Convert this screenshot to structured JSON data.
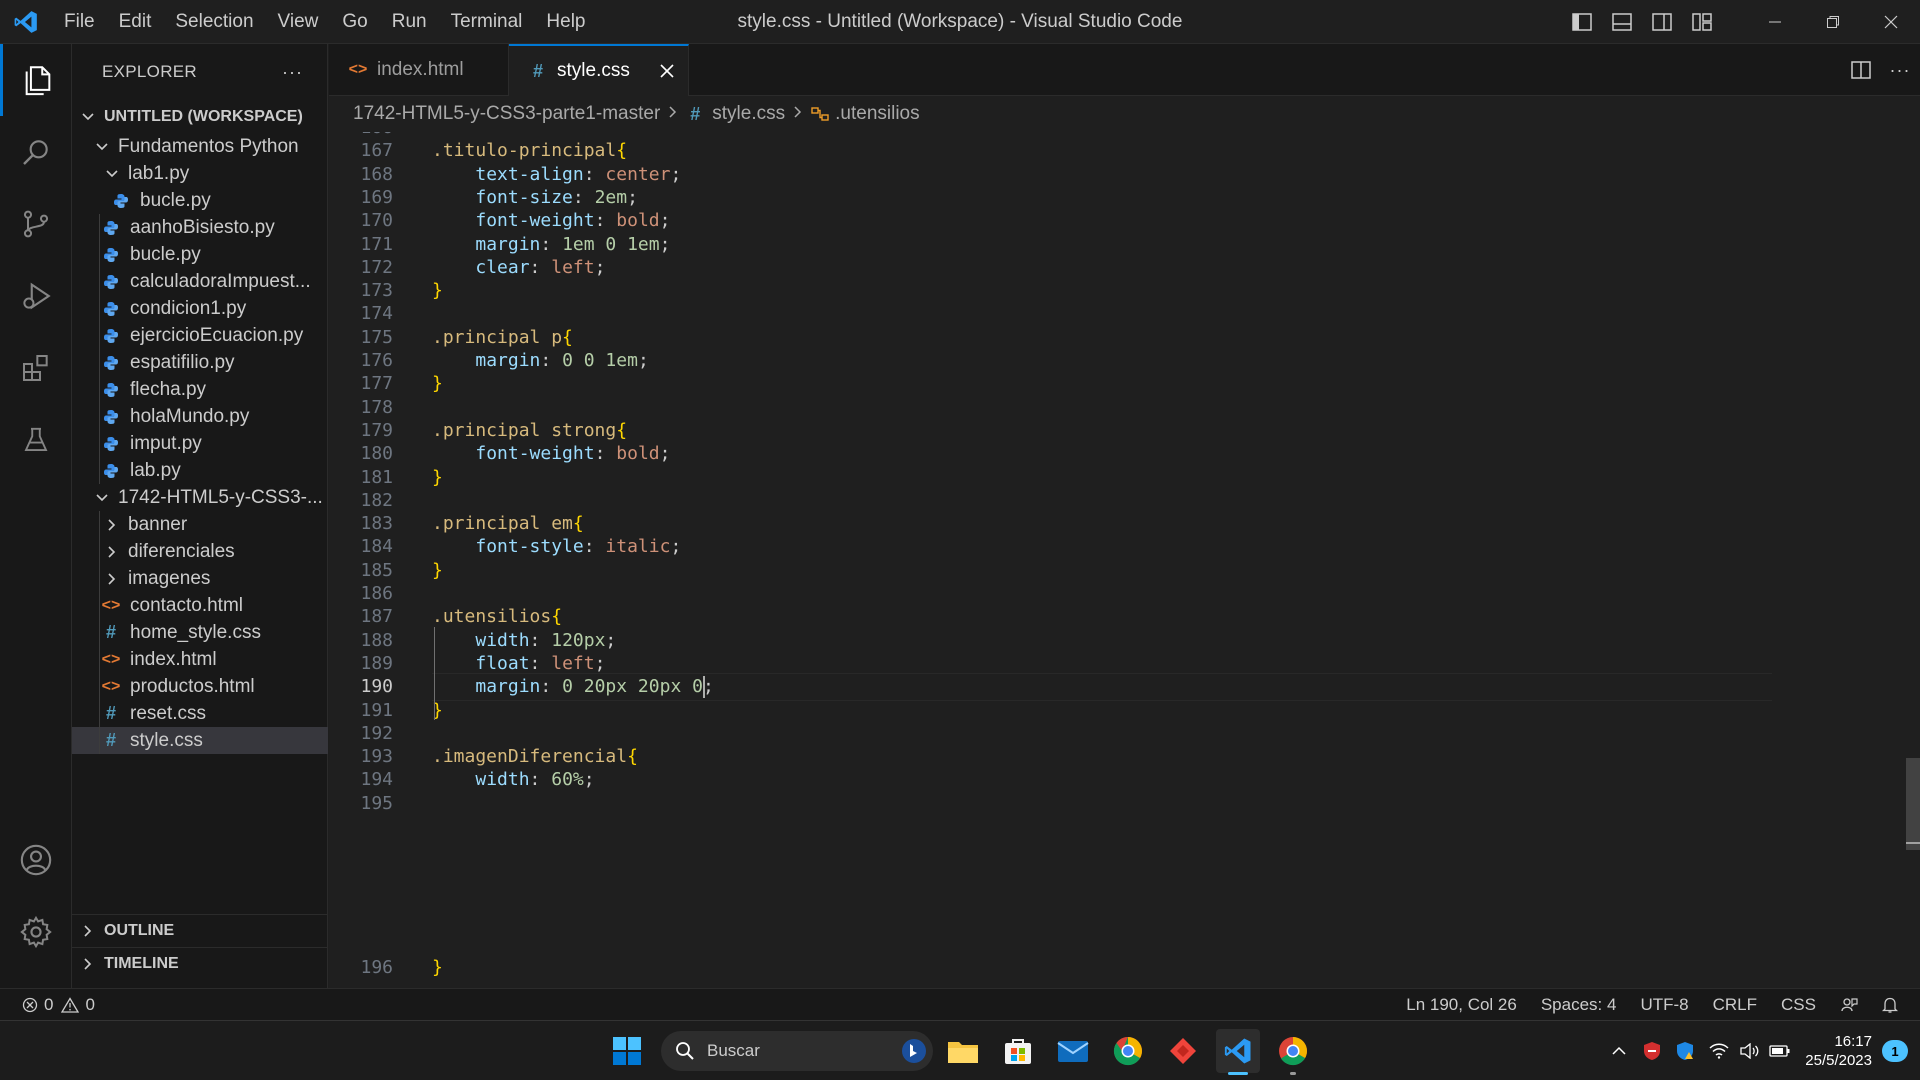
{
  "window": {
    "title": "style.css - Untitled (Workspace) - Visual Studio Code",
    "menu": [
      "File",
      "Edit",
      "Selection",
      "View",
      "Go",
      "Run",
      "Terminal",
      "Help"
    ]
  },
  "sidebar": {
    "title": "EXPLORER",
    "more": "···",
    "workspace": "UNTITLED (WORKSPACE)",
    "tree": [
      {
        "label": "Fundamentos Python",
        "type": "folder-open"
      },
      {
        "label": "lab1.py",
        "type": "folder-open"
      },
      {
        "label": "bucle.py",
        "type": "py"
      },
      {
        "label": "aanhoBisiesto.py",
        "type": "py"
      },
      {
        "label": "bucle.py",
        "type": "py"
      },
      {
        "label": "calculadoraImpuest...",
        "type": "py"
      },
      {
        "label": "condicion1.py",
        "type": "py"
      },
      {
        "label": "ejercicioEcuacion.py",
        "type": "py"
      },
      {
        "label": "espatifilio.py",
        "type": "py"
      },
      {
        "label": "flecha.py",
        "type": "py"
      },
      {
        "label": "holaMundo.py",
        "type": "py"
      },
      {
        "label": "imput.py",
        "type": "py"
      },
      {
        "label": "lab.py",
        "type": "py"
      },
      {
        "label": "1742-HTML5-y-CSS3-...",
        "type": "folder-open"
      },
      {
        "label": "banner",
        "type": "folder-closed"
      },
      {
        "label": "diferenciales",
        "type": "folder-closed"
      },
      {
        "label": "imagenes",
        "type": "folder-closed"
      },
      {
        "label": "contacto.html",
        "type": "html"
      },
      {
        "label": "home_style.css",
        "type": "css"
      },
      {
        "label": "index.html",
        "type": "html"
      },
      {
        "label": "productos.html",
        "type": "html"
      },
      {
        "label": "reset.css",
        "type": "css"
      },
      {
        "label": "style.css",
        "type": "css"
      }
    ],
    "outline": "OUTLINE",
    "timeline": "TIMELINE"
  },
  "tabs": [
    {
      "label": "index.html",
      "icon": "html-icon",
      "active": false
    },
    {
      "label": "style.css",
      "icon": "css-hash-icon",
      "active": true
    }
  ],
  "breadcrumb": {
    "folder": "1742-HTML5-y-CSS3-parte1-master",
    "file": "style.css",
    "symbol": ".utensilios"
  },
  "editor": {
    "partial_top": "166",
    "partial_bottom": "196",
    "current_line": "190",
    "lines": [
      {
        "n": "167",
        "tokens": [
          {
            "t": ".titulo-principal",
            "c": "sel"
          },
          {
            "t": "{",
            "c": "brace"
          }
        ]
      },
      {
        "n": "168",
        "tokens": [
          {
            "t": "    ",
            "c": ""
          },
          {
            "t": "text-align",
            "c": "prop"
          },
          {
            "t": ": ",
            "c": ""
          },
          {
            "t": "center",
            "c": "val"
          },
          {
            "t": ";",
            "c": ""
          }
        ]
      },
      {
        "n": "169",
        "tokens": [
          {
            "t": "    ",
            "c": ""
          },
          {
            "t": "font-size",
            "c": "prop"
          },
          {
            "t": ": ",
            "c": ""
          },
          {
            "t": "2em",
            "c": "num"
          },
          {
            "t": ";",
            "c": ""
          }
        ]
      },
      {
        "n": "170",
        "tokens": [
          {
            "t": "    ",
            "c": ""
          },
          {
            "t": "font-weight",
            "c": "prop"
          },
          {
            "t": ": ",
            "c": ""
          },
          {
            "t": "bold",
            "c": "val"
          },
          {
            "t": ";",
            "c": ""
          }
        ]
      },
      {
        "n": "171",
        "tokens": [
          {
            "t": "    ",
            "c": ""
          },
          {
            "t": "margin",
            "c": "prop"
          },
          {
            "t": ": ",
            "c": ""
          },
          {
            "t": "1em 0 1em",
            "c": "num"
          },
          {
            "t": ";",
            "c": ""
          }
        ]
      },
      {
        "n": "172",
        "tokens": [
          {
            "t": "    ",
            "c": ""
          },
          {
            "t": "clear",
            "c": "prop"
          },
          {
            "t": ": ",
            "c": ""
          },
          {
            "t": "left",
            "c": "val"
          },
          {
            "t": ";",
            "c": ""
          }
        ]
      },
      {
        "n": "173",
        "tokens": [
          {
            "t": "}",
            "c": "brace"
          }
        ]
      },
      {
        "n": "174",
        "tokens": []
      },
      {
        "n": "175",
        "tokens": [
          {
            "t": ".principal p",
            "c": "sel"
          },
          {
            "t": "{",
            "c": "brace"
          }
        ]
      },
      {
        "n": "176",
        "tokens": [
          {
            "t": "    ",
            "c": ""
          },
          {
            "t": "margin",
            "c": "prop"
          },
          {
            "t": ": ",
            "c": ""
          },
          {
            "t": "0 0 1em",
            "c": "num"
          },
          {
            "t": ";",
            "c": ""
          }
        ]
      },
      {
        "n": "177",
        "tokens": [
          {
            "t": "}",
            "c": "brace"
          }
        ]
      },
      {
        "n": "178",
        "tokens": []
      },
      {
        "n": "179",
        "tokens": [
          {
            "t": ".principal strong",
            "c": "sel"
          },
          {
            "t": "{",
            "c": "brace"
          }
        ]
      },
      {
        "n": "180",
        "tokens": [
          {
            "t": "    ",
            "c": ""
          },
          {
            "t": "font-weight",
            "c": "prop"
          },
          {
            "t": ": ",
            "c": ""
          },
          {
            "t": "bold",
            "c": "val"
          },
          {
            "t": ";",
            "c": ""
          }
        ]
      },
      {
        "n": "181",
        "tokens": [
          {
            "t": "}",
            "c": "brace"
          }
        ]
      },
      {
        "n": "182",
        "tokens": []
      },
      {
        "n": "183",
        "tokens": [
          {
            "t": ".principal em",
            "c": "sel"
          },
          {
            "t": "{",
            "c": "brace"
          }
        ]
      },
      {
        "n": "184",
        "tokens": [
          {
            "t": "    ",
            "c": ""
          },
          {
            "t": "font-style",
            "c": "prop"
          },
          {
            "t": ": ",
            "c": ""
          },
          {
            "t": "italic",
            "c": "val"
          },
          {
            "t": ";",
            "c": ""
          }
        ]
      },
      {
        "n": "185",
        "tokens": [
          {
            "t": "}",
            "c": "brace"
          }
        ]
      },
      {
        "n": "186",
        "tokens": []
      },
      {
        "n": "187",
        "tokens": [
          {
            "t": ".utensilios",
            "c": "sel"
          },
          {
            "t": "{",
            "c": "brace"
          }
        ]
      },
      {
        "n": "188",
        "tokens": [
          {
            "t": "    ",
            "c": ""
          },
          {
            "t": "width",
            "c": "prop"
          },
          {
            "t": ": ",
            "c": ""
          },
          {
            "t": "120px",
            "c": "num"
          },
          {
            "t": ";",
            "c": ""
          }
        ]
      },
      {
        "n": "189",
        "tokens": [
          {
            "t": "    ",
            "c": ""
          },
          {
            "t": "float",
            "c": "prop"
          },
          {
            "t": ": ",
            "c": ""
          },
          {
            "t": "left",
            "c": "val"
          },
          {
            "t": ";",
            "c": ""
          }
        ]
      },
      {
        "n": "190",
        "tokens": [
          {
            "t": "    ",
            "c": ""
          },
          {
            "t": "margin",
            "c": "prop"
          },
          {
            "t": ": ",
            "c": ""
          },
          {
            "t": "0 20px 20px 0",
            "c": "num"
          },
          {
            "t": ";",
            "c": ""
          }
        ]
      },
      {
        "n": "191",
        "tokens": [
          {
            "t": "}",
            "c": "brace"
          }
        ]
      },
      {
        "n": "192",
        "tokens": []
      },
      {
        "n": "193",
        "tokens": [
          {
            "t": ".imagenDiferencial",
            "c": "sel"
          },
          {
            "t": "{",
            "c": "brace"
          }
        ]
      },
      {
        "n": "194",
        "tokens": [
          {
            "t": "    ",
            "c": ""
          },
          {
            "t": "width",
            "c": "prop"
          },
          {
            "t": ": ",
            "c": ""
          },
          {
            "t": "60%",
            "c": "num"
          },
          {
            "t": ";",
            "c": ""
          }
        ]
      },
      {
        "n": "195",
        "tokens": []
      }
    ]
  },
  "statusbar": {
    "errors": "0",
    "warnings": "0",
    "position": "Ln 190, Col 26",
    "spaces": "Spaces: 4",
    "encoding": "UTF-8",
    "eol": "CRLF",
    "language": "CSS"
  },
  "taskbar": {
    "search_placeholder": "Buscar",
    "time": "16:17",
    "date": "25/5/2023",
    "notifications": "1"
  },
  "colors": {
    "accent": "#0078d4",
    "selector": "#d7ba7d",
    "property": "#9cdcfe",
    "value": "#ce9178",
    "number": "#b5cea8",
    "brace": "#ffd700"
  }
}
